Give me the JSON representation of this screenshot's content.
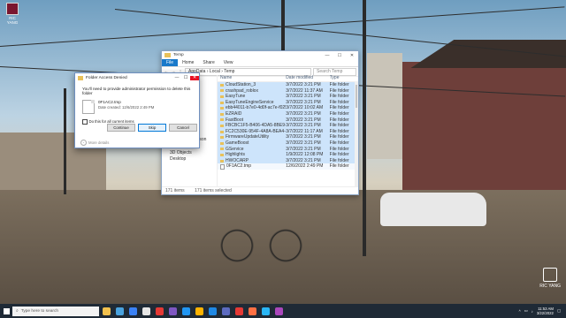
{
  "desktop": {
    "icon_label": "RIC YANG"
  },
  "explorer": {
    "title": "Temp",
    "ribbon": [
      "File",
      "Home",
      "Share",
      "View"
    ],
    "path": [
      "AppData",
      "Local",
      "Temp"
    ],
    "search_placeholder": "Search Temp",
    "nav_items": [
      "Videos",
      "OneDrive - Person",
      "This PC",
      "3D Objects",
      "Desktop"
    ],
    "columns": {
      "name": "Name",
      "date": "Date modified",
      "type": "Type"
    },
    "files": [
      {
        "name": "CloudStation_3",
        "date": "3/7/2022 3:21 PM",
        "type": "File folder"
      },
      {
        "name": "crashpad_roblox",
        "date": "3/7/2022 11:37 AM",
        "type": "File folder"
      },
      {
        "name": "EasyTune",
        "date": "3/7/2022 3:21 PM",
        "type": "File folder"
      },
      {
        "name": "EasyTuneEngineService",
        "date": "3/7/2022 3:21 PM",
        "type": "File folder"
      },
      {
        "name": "ebb44011-b7e0-4d0f-ac7e-f025ed2d7b9f",
        "date": "3/7/2022 10:02 AM",
        "type": "File folder"
      },
      {
        "name": "EZRAID",
        "date": "3/7/2022 3:21 PM",
        "type": "File folder"
      },
      {
        "name": "FastBoot",
        "date": "3/7/2022 3:21 PM",
        "type": "File folder"
      },
      {
        "name": "FBCBC1F5-B406-4DA5-8BE9-A3E5AD3D6...",
        "date": "3/7/2022 3:21 PM",
        "type": "File folder"
      },
      {
        "name": "FC2C530E-954F-4A8A-BEA4-44B4F4C36...",
        "date": "3/7/2022 11:17 AM",
        "type": "File folder"
      },
      {
        "name": "FirmwareUpdateUtility",
        "date": "3/7/2022 3:21 PM",
        "type": "File folder"
      },
      {
        "name": "GameBoost",
        "date": "3/7/2022 3:21 PM",
        "type": "File folder"
      },
      {
        "name": "GService",
        "date": "3/7/2022 3:21 PM",
        "type": "File folder"
      },
      {
        "name": "Highlights",
        "date": "1/9/2022 12:08 PM",
        "type": "File folder"
      },
      {
        "name": "HWOCARP",
        "date": "3/7/2022 3:21 PM",
        "type": "File folder"
      },
      {
        "name": "0F1AC2.tmp",
        "date": "12/6/2022 2:49 PM",
        "type": "File folder"
      }
    ],
    "status": {
      "count": "171 items",
      "selected": "171 items selected"
    }
  },
  "dialog": {
    "title": "Folder Access Denied",
    "message": "You'll need to provide administrator permission to delete this folder",
    "file_name": "0F1AC2.tmp",
    "file_date": "Date created: 12/6/2022 2:49 PM",
    "checkbox_label": "Do this for all current items",
    "buttons": {
      "continue": "Continue",
      "skip": "Skip",
      "cancel": "Cancel"
    },
    "more_details": "More details"
  },
  "taskbar": {
    "search_placeholder": "Type here to search",
    "time": "11:53 AM",
    "date": "3/22/2022",
    "icon_colors": [
      "#f2c14e",
      "#4aa3df",
      "#3b82f6",
      "#e6e6e6",
      "#e53935",
      "#7e57c2",
      "#2196f3",
      "#ffb300",
      "#1e88e5",
      "#5c6bc0",
      "#e53935",
      "#ff7043",
      "#29b6f6",
      "#ab47bc"
    ]
  },
  "watermark": {
    "text": "RIC YANG"
  }
}
